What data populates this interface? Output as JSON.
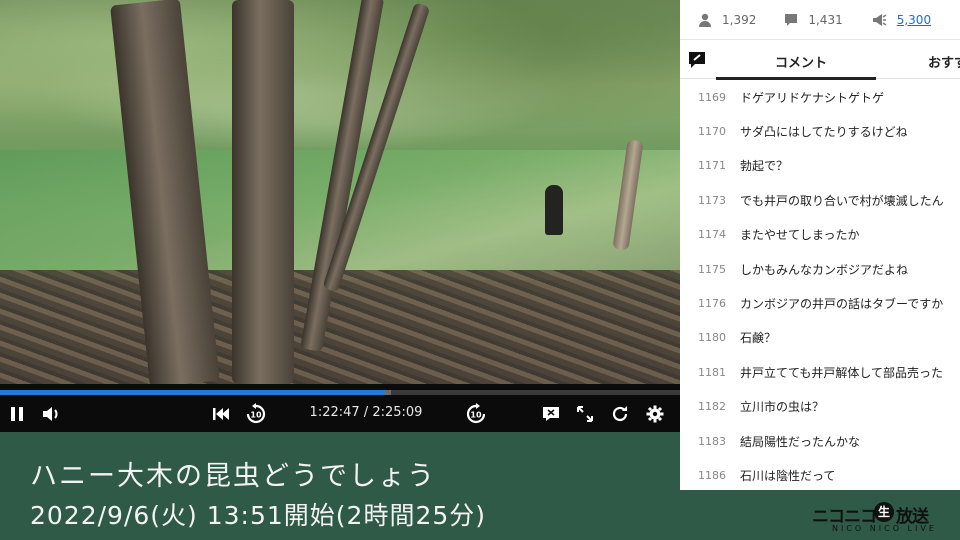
{
  "player": {
    "progress_fraction": 0.5664,
    "buffered_fraction": 0.575,
    "time_current": "1:22:47",
    "time_separator": " / ",
    "time_total": "2:25:09",
    "icons": [
      "pause-icon",
      "volume-icon",
      "skip-to-start-icon",
      "rewind-10-icon",
      "forward-10-icon",
      "comment-toggle-icon",
      "fullscreen-icon",
      "reload-icon",
      "settings-icon"
    ],
    "accent": "#1f7be0"
  },
  "caption": {
    "title": "ハニー大木の昆虫どうでしょう",
    "date": "2022/9/6(火) 13:51開始(2時間25分)",
    "background": "#2f5a47"
  },
  "panel": {
    "stats": {
      "viewers": "1,392",
      "comments": "1,431",
      "ads": "5,300"
    },
    "tabs": {
      "comment": "コメント",
      "recommend": "おすす"
    },
    "comments": [
      {
        "no": "1169",
        "text": "ドゲアリドケナシトゲトゲ"
      },
      {
        "no": "1170",
        "text": "サダ凸にはしてたりするけどね"
      },
      {
        "no": "1171",
        "text": "勃起で？"
      },
      {
        "no": "1173",
        "text": "でも井戸の取り合いで村が壊滅したん"
      },
      {
        "no": "1174",
        "text": "またやせてしまったか"
      },
      {
        "no": "1175",
        "text": "しかもみんなカンボジアだよね"
      },
      {
        "no": "1176",
        "text": "カンボジアの井戸の話はタブーですか"
      },
      {
        "no": "1180",
        "text": "石鹸？"
      },
      {
        "no": "1181",
        "text": "井戸立てても井戸解体して部品売った"
      },
      {
        "no": "1182",
        "text": "立川市の虫は？"
      },
      {
        "no": "1183",
        "text": "結局陽性だったんかな"
      },
      {
        "no": "1186",
        "text": "石川は陰性だって"
      }
    ]
  },
  "logo": {
    "main_left": "ニコニコ",
    "main_dot": "生",
    "main_right": "放送",
    "sub": "NICO NICO LIVE"
  }
}
